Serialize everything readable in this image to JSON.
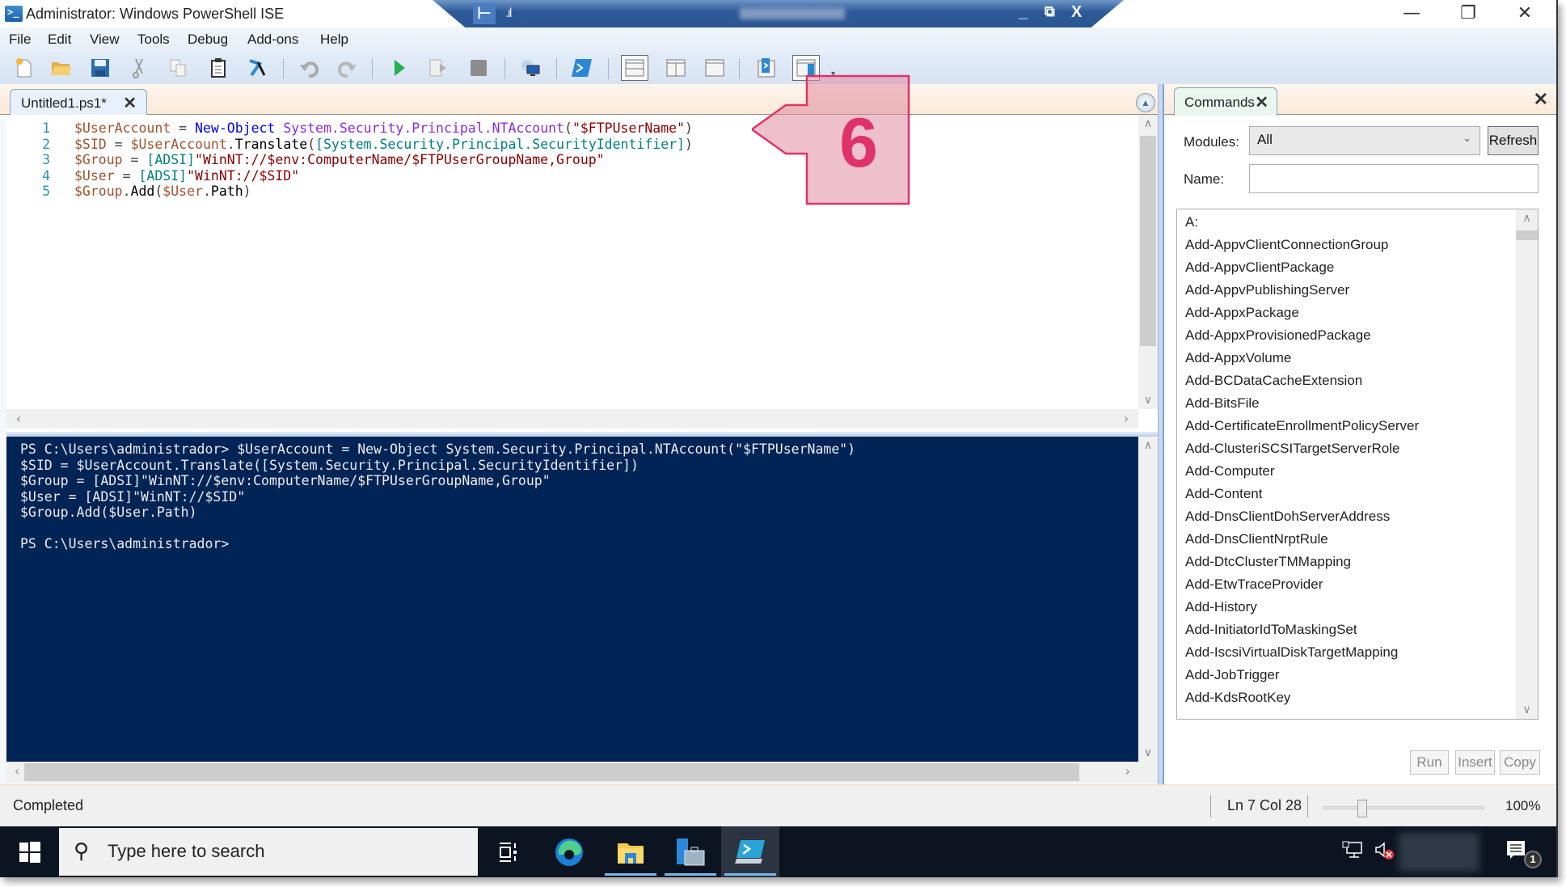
{
  "window": {
    "title": "Administrator: Windows PowerShell ISE",
    "controls": {
      "minimize": "—",
      "restore": "❐",
      "close": "✕"
    }
  },
  "rdp_bar": {
    "pin_icon": "pin-icon",
    "signal_icon": "connection-signal-icon",
    "host": "",
    "minimize": "_",
    "restore": "⧉",
    "close": "X"
  },
  "menu": [
    "File",
    "Edit",
    "View",
    "Tools",
    "Debug",
    "Add-ons",
    "Help"
  ],
  "toolbar": {
    "buttons": [
      "new-script",
      "open",
      "save",
      "cut",
      "copy",
      "paste",
      "clear-console",
      "undo",
      "redo",
      "run-script",
      "run-selection",
      "stop",
      "new-remote-tab",
      "start-powershell",
      "show-script-top",
      "show-script-right",
      "show-script-maximized",
      "show-script-pane",
      "show-command-addon"
    ]
  },
  "editor": {
    "tab_label": "Untitled1.ps1*",
    "tab_close": "✕",
    "lines": [
      {
        "n": "1",
        "tokens": [
          [
            "var",
            "$UserAccount"
          ],
          [
            "op",
            " = "
          ],
          [
            "cmd",
            "New-Object"
          ],
          [
            "plain",
            " "
          ],
          [
            "type",
            "System.Security.Principal.NTAccount"
          ],
          [
            "op",
            "("
          ],
          [
            "str",
            "\"$FTPUserName\""
          ],
          [
            "op",
            ")"
          ]
        ]
      },
      {
        "n": "2",
        "tokens": [
          [
            "var",
            "$SID"
          ],
          [
            "op",
            " = "
          ],
          [
            "var",
            "$UserAccount"
          ],
          [
            "op",
            "."
          ],
          [
            "plain",
            "Translate"
          ],
          [
            "op",
            "("
          ],
          [
            "type2",
            "[System.Security.Principal.SecurityIdentifier]"
          ],
          [
            "op",
            ")"
          ]
        ]
      },
      {
        "n": "3",
        "tokens": [
          [
            "var",
            "$Group"
          ],
          [
            "op",
            " = "
          ],
          [
            "type2",
            "[ADSI]"
          ],
          [
            "str",
            "\"WinNT://$env:ComputerName/$FTPUserGroupName,Group\""
          ]
        ]
      },
      {
        "n": "4",
        "tokens": [
          [
            "var",
            "$User"
          ],
          [
            "op",
            " = "
          ],
          [
            "type2",
            "[ADSI]"
          ],
          [
            "str",
            "\"WinNT://$SID\""
          ]
        ]
      },
      {
        "n": "5",
        "tokens": [
          [
            "var",
            "$Group"
          ],
          [
            "op",
            "."
          ],
          [
            "plain",
            "Add"
          ],
          [
            "op",
            "("
          ],
          [
            "var",
            "$User"
          ],
          [
            "op",
            "."
          ],
          [
            "plain",
            "Path"
          ],
          [
            "op",
            ")"
          ]
        ]
      }
    ]
  },
  "console": {
    "lines": [
      "PS C:\\Users\\administrador> $UserAccount = New-Object System.Security.Principal.NTAccount(\"$FTPUserName\")",
      "$SID = $UserAccount.Translate([System.Security.Principal.SecurityIdentifier])",
      "$Group = [ADSI]\"WinNT://$env:ComputerName/$FTPUserGroupName,Group\"",
      "$User = [ADSI]\"WinNT://$SID\"",
      "$Group.Add($User.Path)",
      "",
      "PS C:\\Users\\administrador>"
    ]
  },
  "commands_pane": {
    "tab_label": "Commands",
    "tab_close": "✕",
    "pane_close": "✕",
    "modules_label": "Modules:",
    "modules_value": "All",
    "refresh_label": "Refresh",
    "name_label": "Name:",
    "name_value": "",
    "items": [
      "A:",
      "Add-AppvClientConnectionGroup",
      "Add-AppvClientPackage",
      "Add-AppvPublishingServer",
      "Add-AppxPackage",
      "Add-AppxProvisionedPackage",
      "Add-AppxVolume",
      "Add-BCDataCacheExtension",
      "Add-BitsFile",
      "Add-CertificateEnrollmentPolicyServer",
      "Add-ClusteriSCSITargetServerRole",
      "Add-Computer",
      "Add-Content",
      "Add-DnsClientDohServerAddress",
      "Add-DnsClientNrptRule",
      "Add-DtcClusterTMMapping",
      "Add-EtwTraceProvider",
      "Add-History",
      "Add-InitiatorIdToMaskingSet",
      "Add-IscsiVirtualDiskTargetMapping",
      "Add-JobTrigger",
      "Add-KdsRootKey"
    ],
    "run_label": "Run",
    "insert_label": "Insert",
    "copy_label": "Copy"
  },
  "status": {
    "text": "Completed",
    "cursor": "Ln 7  Col 28",
    "zoom": "100%",
    "zoom_fraction": 0.22
  },
  "taskbar": {
    "search_placeholder": "Type here to search",
    "apps": [
      "task-view",
      "edge",
      "file-explorer",
      "server-manager",
      "powershell-ise"
    ],
    "notification_count": "1"
  },
  "annotation": {
    "label": "6",
    "color": "#e0326a"
  }
}
